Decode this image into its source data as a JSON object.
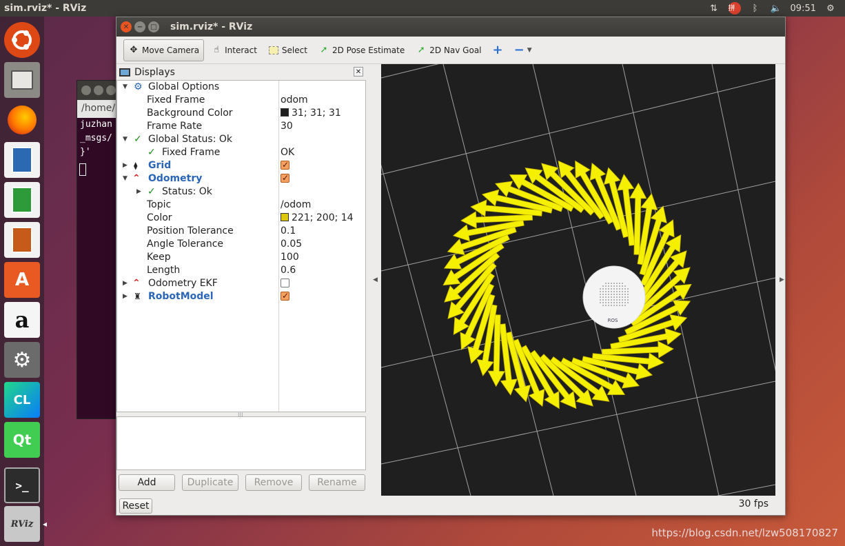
{
  "top_panel": {
    "title": "sim.rviz* - RViz",
    "time": "09:51",
    "ime": "拼"
  },
  "launcher": {
    "items": [
      {
        "name": "ubuntu-dash",
        "label": "",
        "color": "#dd4814"
      },
      {
        "name": "files",
        "label": "",
        "color": "#8c8a85"
      },
      {
        "name": "firefox",
        "label": "",
        "color": "#e66000"
      },
      {
        "name": "writer",
        "label": "",
        "color": "#2b6ab3"
      },
      {
        "name": "calc",
        "label": "",
        "color": "#2e9b3b"
      },
      {
        "name": "impress",
        "label": "",
        "color": "#c65a1a"
      },
      {
        "name": "software",
        "label": "A",
        "color": "#e85a22"
      },
      {
        "name": "amazon",
        "label": "a",
        "color": "#ffffff"
      },
      {
        "name": "settings",
        "label": "",
        "color": "#6b6b6b"
      },
      {
        "name": "clion",
        "label": "CL",
        "color": "#1fb2a6"
      },
      {
        "name": "qt",
        "label": "Qt",
        "color": "#41cd52"
      },
      {
        "name": "terminal",
        "label": ">_",
        "color": "#2c2c2c"
      },
      {
        "name": "rviz",
        "label": "RViz",
        "color": "#c8c8c8"
      }
    ]
  },
  "terminal": {
    "path": "/home/",
    "lines": [
      "juzhan",
      "_msgs/",
      "}'"
    ]
  },
  "rviz": {
    "title": "sim.rviz* - RViz",
    "toolbar": {
      "move_camera": "Move Camera",
      "interact": "Interact",
      "select": "Select",
      "pose_estimate": "2D Pose Estimate",
      "nav_goal": "2D Nav Goal"
    },
    "displays": {
      "title": "Displays",
      "rows": {
        "global_options": "Global Options",
        "fixed_frame": {
          "name": "Fixed Frame",
          "value": "odom"
        },
        "background_color": {
          "name": "Background Color",
          "value": "31; 31; 31",
          "swatch": "#1f1f1f"
        },
        "frame_rate": {
          "name": "Frame Rate",
          "value": "30"
        },
        "global_status": "Global Status: Ok",
        "fixed_frame_status": {
          "name": "Fixed Frame",
          "value": "OK"
        },
        "grid": "Grid",
        "odometry": "Odometry",
        "status_ok": "Status: Ok",
        "topic": {
          "name": "Topic",
          "value": "/odom"
        },
        "color": {
          "name": "Color",
          "value": "221; 200; 14",
          "swatch": "#ddc80e"
        },
        "position_tolerance": {
          "name": "Position Tolerance",
          "value": "0.1"
        },
        "angle_tolerance": {
          "name": "Angle Tolerance",
          "value": "0.05"
        },
        "keep": {
          "name": "Keep",
          "value": "100"
        },
        "length": {
          "name": "Length",
          "value": "0.6"
        },
        "odometry_ekf": "Odometry EKF",
        "robot_model": "RobotModel"
      },
      "buttons": {
        "add": "Add",
        "duplicate": "Duplicate",
        "remove": "Remove",
        "rename": "Rename"
      }
    },
    "reset": "Reset",
    "fps": "30 fps",
    "robot_label": "ROS"
  },
  "watermark": "https://blog.csdn.net/lzw508170827"
}
